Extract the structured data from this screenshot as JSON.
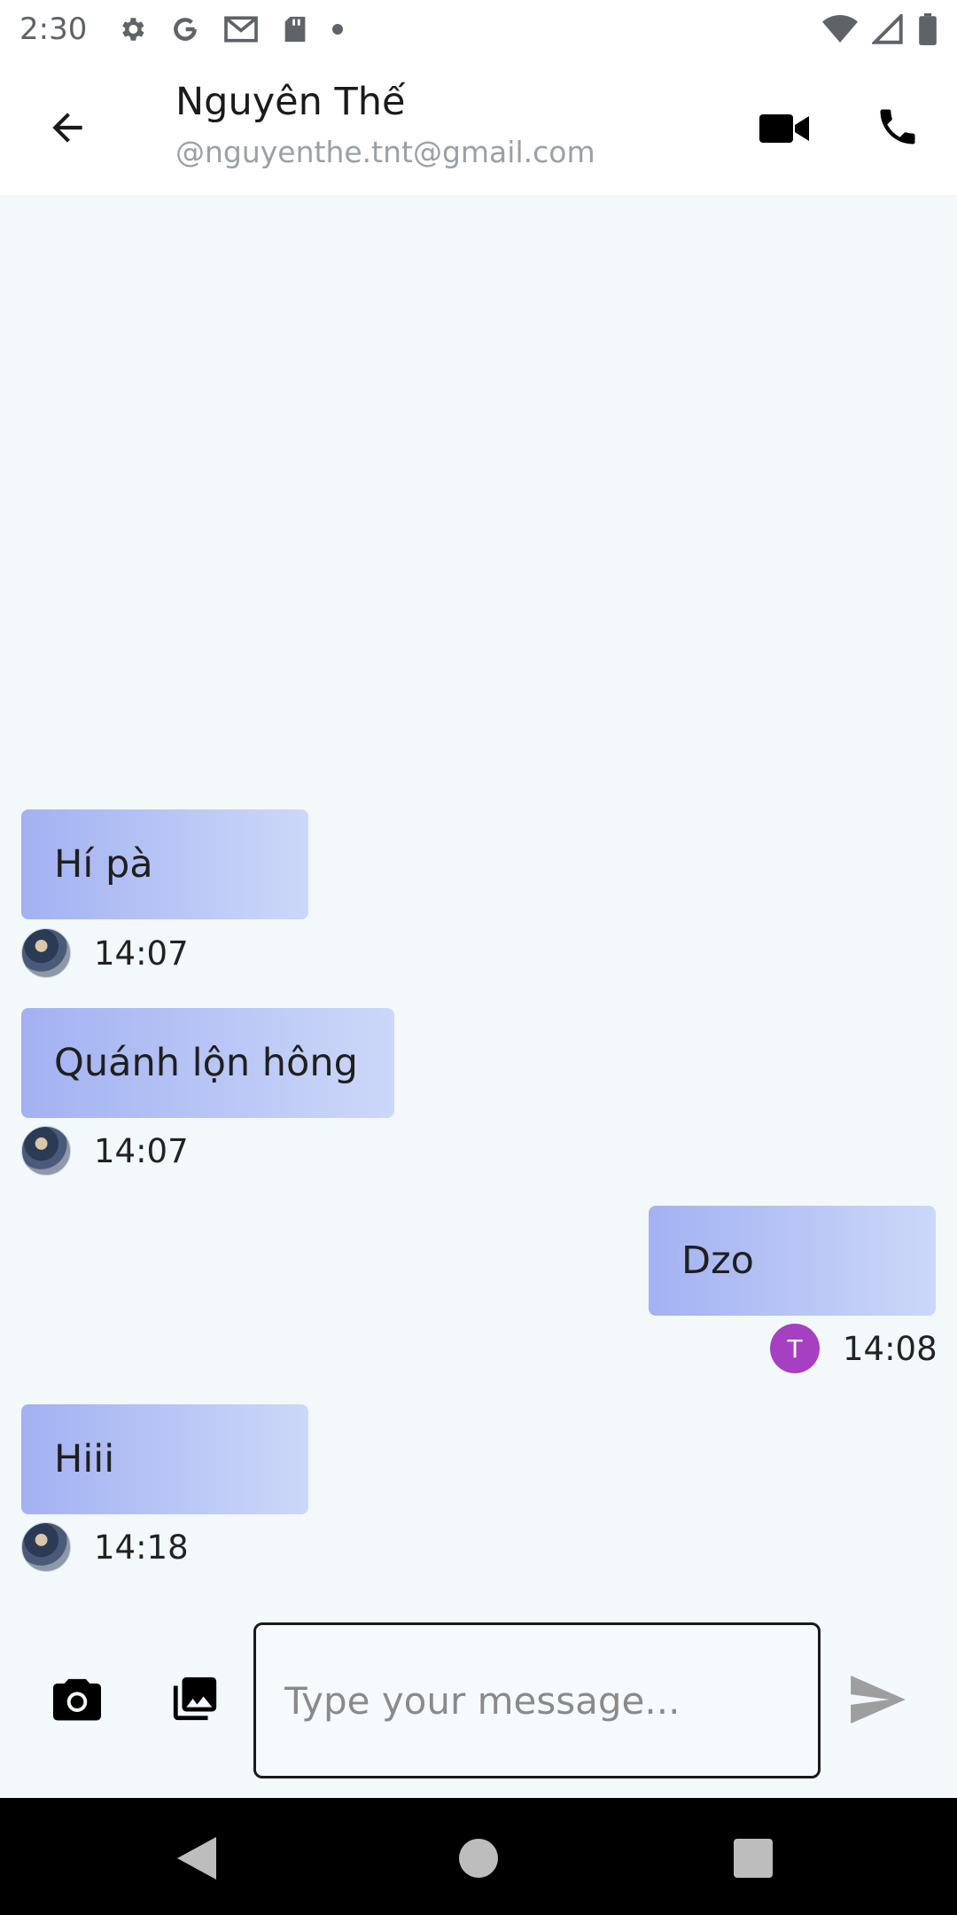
{
  "status_bar": {
    "time": "2:30",
    "left_icons": [
      "gear-icon",
      "google-icon",
      "gmail-icon",
      "sd-card-icon",
      "dot-icon"
    ],
    "right_icons": [
      "wifi-icon",
      "signal-icon",
      "battery-icon"
    ]
  },
  "header": {
    "contact_name": "Nguyên Thế",
    "contact_email": "@nguyenthe.tnt@gmail.com",
    "icons": [
      "back-arrow-icon",
      "video-camera-icon",
      "phone-icon"
    ]
  },
  "messages": [
    {
      "text": "Hí pà",
      "time": "14:07",
      "sender": "contact",
      "avatar": "photo"
    },
    {
      "text": "Quánh lộn hông",
      "time": "14:07",
      "sender": "contact",
      "avatar": "photo"
    },
    {
      "text": "Dzo",
      "time": "14:08",
      "sender": "me",
      "avatar_letter": "T",
      "avatar_color": "#a63fc2"
    },
    {
      "text": "Hiii",
      "time": "14:18",
      "sender": "contact",
      "avatar": "photo"
    }
  ],
  "composer": {
    "placeholder": "Type your message...",
    "value": "",
    "icons": [
      "camera-icon",
      "gallery-icon",
      "send-icon"
    ]
  },
  "colors": {
    "bubble_start": "#a3b1f2",
    "bubble_end": "#ccd8f8",
    "chat_background": "#f3f8fb",
    "avatar_letter_bg": "#a63fc2"
  },
  "nav_bar": {
    "icons": [
      "nav-back-icon",
      "nav-home-icon",
      "nav-recents-icon"
    ]
  }
}
